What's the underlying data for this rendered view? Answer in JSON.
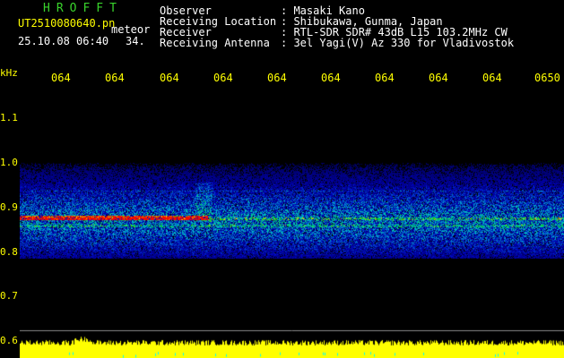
{
  "header": {
    "brand": "HROFFT",
    "filename": "UT2510080640.pn",
    "file_type": "meteor",
    "datetime": "25.10.08 06:40",
    "count": "34.",
    "fields": [
      {
        "label": "Observer",
        "value": ": Masaki Kano"
      },
      {
        "label": "Receiving Location",
        "value": ": Shibukawa, Gunma, Japan"
      },
      {
        "label": "Receiver",
        "value": ": RTL-SDR SDR# 43dB L15 103.2MHz CW"
      },
      {
        "label": "Receiving Antenna",
        "value": ": 3el Yagi(V) Az 330 for Vladivostok"
      }
    ]
  },
  "axes": {
    "y_unit": "kHz",
    "y_ticks": [
      "1.1",
      "1.0",
      "0.9",
      "0.8",
      "0.7",
      "0.6"
    ],
    "x_ticks": [
      "064",
      "064",
      "064",
      "064",
      "064",
      "064",
      "064",
      "064",
      "064",
      "0650"
    ]
  },
  "colors": {
    "background": "#000000",
    "label": "#ffff00",
    "brand": "#39d32c",
    "text": "#ffffff"
  }
}
